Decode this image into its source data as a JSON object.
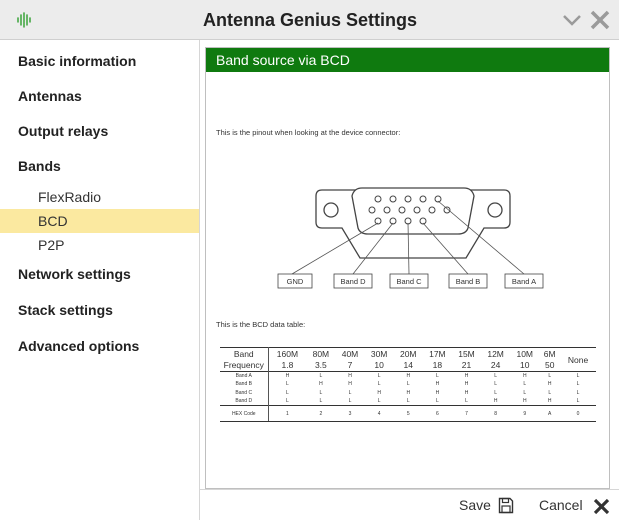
{
  "window": {
    "title": "Antenna Genius Settings"
  },
  "sidebar": {
    "items": [
      {
        "label": "Basic information"
      },
      {
        "label": "Antennas"
      },
      {
        "label": "Output relays"
      },
      {
        "label": "Bands"
      },
      {
        "label": "FlexRadio"
      },
      {
        "label": "BCD"
      },
      {
        "label": "P2P"
      },
      {
        "label": "Network settings"
      },
      {
        "label": "Stack settings"
      },
      {
        "label": "Advanced options"
      }
    ],
    "selected": "BCD",
    "selected_color": "#fbe9a0"
  },
  "panel": {
    "header": "Band source via BCD",
    "header_color": "#0f7a0f",
    "pinout_text": "This is the pinout when looking at the device connector:",
    "pin_labels": [
      "GND",
      "Band D",
      "Band C",
      "Band B",
      "Band A"
    ],
    "table_text": "This is the BCD data table:",
    "table": {
      "header_band": "Band",
      "header_freq": "Frequency",
      "bands": [
        "160M",
        "80M",
        "40M",
        "30M",
        "20M",
        "17M",
        "15M",
        "12M",
        "10M",
        "6M"
      ],
      "freqs": [
        "1.8",
        "3.5",
        "7",
        "10",
        "14",
        "18",
        "21",
        "24",
        "10",
        "50"
      ],
      "none_label": "None",
      "rows": [
        {
          "name": "Band A",
          "values": [
            "H",
            "L",
            "H",
            "L",
            "H",
            "L",
            "H",
            "L",
            "H",
            "L",
            "L"
          ]
        },
        {
          "name": "Band B",
          "values": [
            "L",
            "H",
            "H",
            "L",
            "L",
            "H",
            "H",
            "L",
            "L",
            "H",
            "L"
          ]
        },
        {
          "name": "Band C",
          "values": [
            "L",
            "L",
            "L",
            "H",
            "H",
            "H",
            "H",
            "L",
            "L",
            "L",
            "L"
          ]
        },
        {
          "name": "Band D",
          "values": [
            "L",
            "L",
            "L",
            "L",
            "L",
            "L",
            "L",
            "H",
            "H",
            "H",
            "L"
          ]
        }
      ],
      "code_label": "HEX Code",
      "codes": [
        "1",
        "2",
        "3",
        "4",
        "5",
        "6",
        "7",
        "8",
        "9",
        "A",
        "0"
      ]
    }
  },
  "footer": {
    "save_label": "Save",
    "cancel_label": "Cancel"
  },
  "icons": {
    "app": "antenna-waveform-icon",
    "chevron": "chevron-down-icon",
    "close": "close-icon",
    "save": "floppy-disk-icon",
    "cancel": "x-icon"
  }
}
